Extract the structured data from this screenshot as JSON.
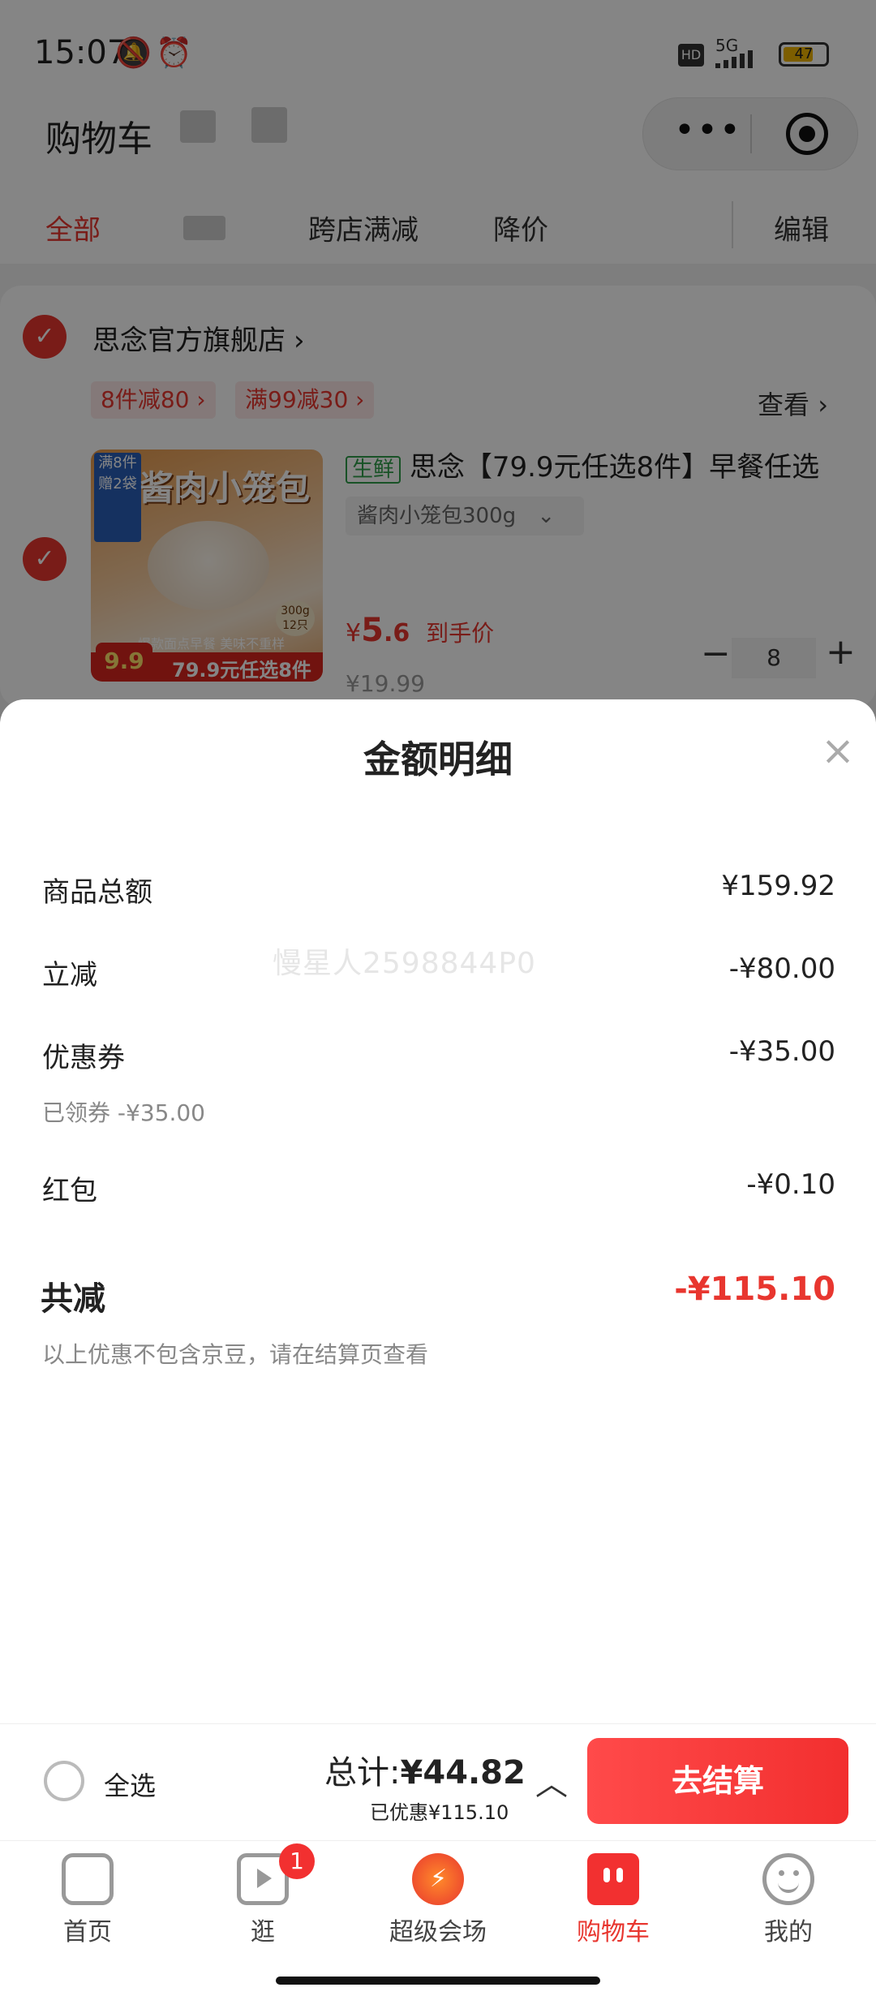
{
  "status_bar": {
    "time": "15:07",
    "battery": "47",
    "network": "5G",
    "hd": "HD"
  },
  "header": {
    "title": "购物车"
  },
  "tabs": {
    "all": "全部",
    "cross_store": "跨店满减",
    "price_drop": "降价",
    "edit": "编辑"
  },
  "shop": {
    "name": "思念官方旗舰店",
    "promo_1": "8件减80",
    "promo_2": "满99减30",
    "view": "查看"
  },
  "product": {
    "fresh_tag": "生鲜",
    "title": "思念【79.9元任选8件】早餐任选",
    "spec": "酱肉小笼包300g",
    "price_symbol": "¥",
    "price_int": "5",
    "price_dec": ".6",
    "price_note": "到手价",
    "orig_price": "¥19.99",
    "quantity": "8",
    "image_text_main": "酱肉小笼包",
    "image_text_banner": "79.9元任选8件",
    "image_text_badge": "9.9",
    "image_text_slogan": "爆款面点早餐 美味不重样",
    "image_text_weight": "300g",
    "image_text_count": "12只",
    "image_text_top": "满8件",
    "image_text_top2": "赠2袋"
  },
  "sheet": {
    "title": "金额明细",
    "close": "×",
    "rows": [
      {
        "label": "商品总额",
        "value": "¥159.92"
      },
      {
        "label": "立减",
        "value": "-¥80.00"
      },
      {
        "label": "优惠券",
        "value": "-¥35.00"
      },
      {
        "label": "红包",
        "value": "-¥0.10"
      }
    ],
    "coupon_note": "已领券 -¥35.00",
    "watermark": "慢星人2598844P0",
    "total_label": "共减",
    "total_value": "-¥115.10",
    "footnote": "以上优惠不包含京豆，请在结算页查看"
  },
  "bottom_bar": {
    "select_all": "全选",
    "total_label": "总计:",
    "total_value": "¥44.82",
    "saved": "已优惠¥115.10",
    "checkout": "去结算"
  },
  "nav": {
    "items": [
      {
        "label": "首页"
      },
      {
        "label": "逛",
        "badge": "1"
      },
      {
        "label": "超级会场"
      },
      {
        "label": "购物车"
      },
      {
        "label": "我的"
      }
    ]
  },
  "colors": {
    "accent": "#e8362f",
    "fresh": "#2e9e4a"
  }
}
